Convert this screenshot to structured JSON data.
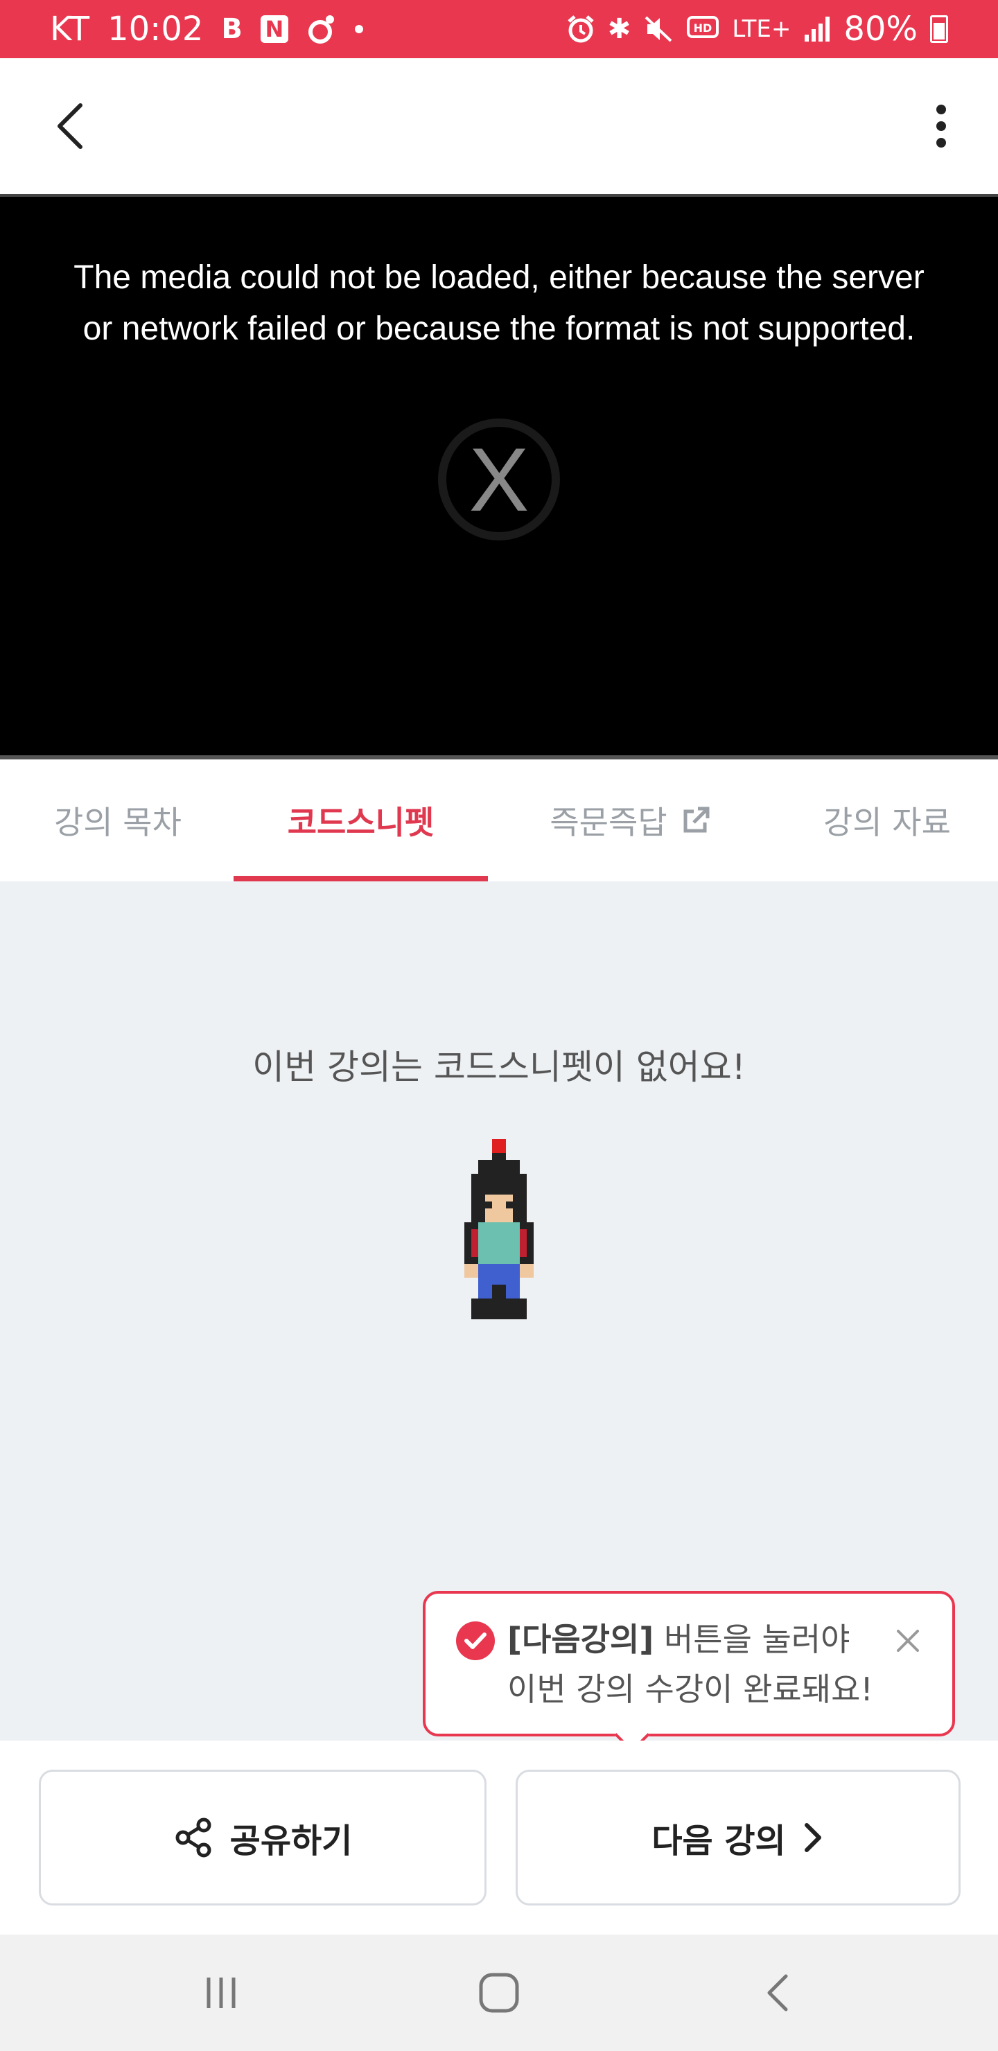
{
  "status_bar": {
    "carrier": "KT",
    "time": "10:02",
    "app_badges": [
      "B",
      "N"
    ],
    "network": "LTE+",
    "battery": "80%"
  },
  "video": {
    "error_message": "The media could not be loaded, either because the server or network failed or because the format is not supported.",
    "error_icon_glyph": "X"
  },
  "tabs": [
    {
      "label": "강의 목차",
      "active": false
    },
    {
      "label": "코드스니펫",
      "active": true
    },
    {
      "label": "즉문즉답",
      "active": false,
      "icon": "external-link-icon"
    },
    {
      "label": "강의 자료",
      "active": false
    }
  ],
  "content": {
    "empty_message": "이번 강의는 코드스니펫이 없어요!"
  },
  "tooltip": {
    "highlight": "[다음강의]",
    "line1_rest": " 버튼을 눌러야",
    "line2": "이번 강의 수강이 완료돼요!"
  },
  "bottom_buttons": {
    "share_label": "공유하기",
    "next_label": "다음 강의"
  },
  "colors": {
    "accent": "#e8374f",
    "status_bar": "#e8374f",
    "content_bg": "#eef1f4"
  }
}
